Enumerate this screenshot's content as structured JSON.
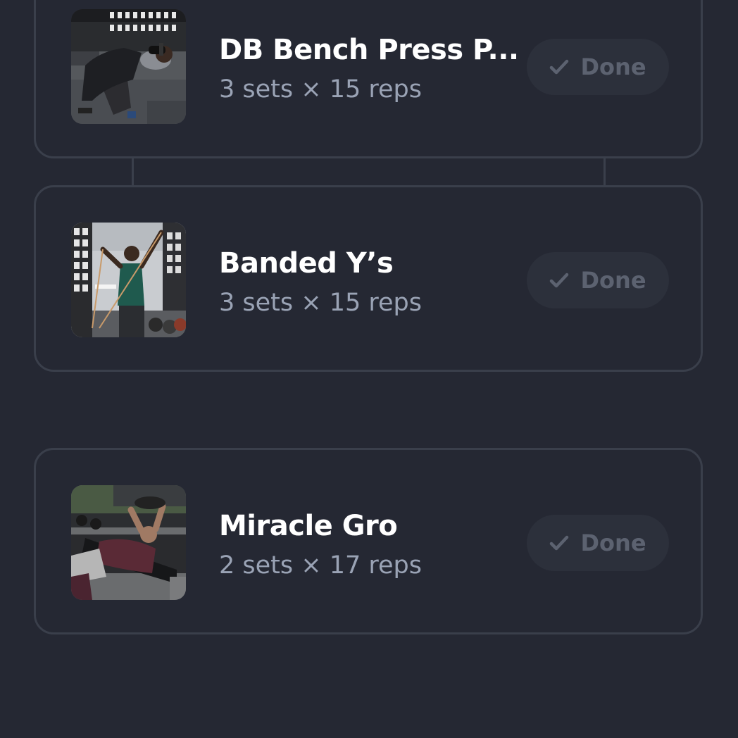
{
  "exercises": [
    {
      "name": "DB Bench Press P...",
      "meta": "3 sets × 15 reps",
      "done_label": "Done",
      "thumbnail": "person-bench-press-dumbbells-photo"
    },
    {
      "name": "Banded Y’s",
      "meta": "3 sets × 15 reps",
      "done_label": "Done",
      "thumbnail": "person-resistance-band-y-raise-photo"
    },
    {
      "name": "Miracle Gro",
      "meta": "2 sets × 17 reps",
      "done_label": "Done",
      "thumbnail": "person-lying-bench-dumbbell-photo"
    }
  ],
  "colors": {
    "background": "#252833",
    "card_border": "#3a3f4b",
    "title": "#ffffff",
    "meta": "#9aa3b5",
    "done_bg": "#2c303b",
    "done_text": "#5c6270"
  },
  "icons": {
    "done": "check-icon"
  }
}
